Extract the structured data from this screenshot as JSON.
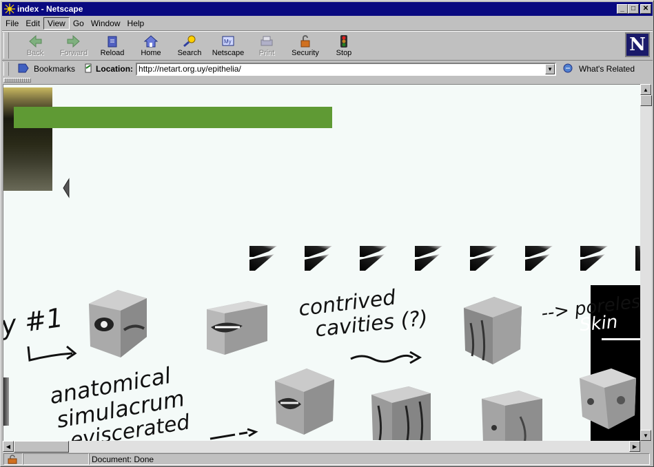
{
  "window": {
    "title": "index - Netscape"
  },
  "menu": [
    "File",
    "Edit",
    "View",
    "Go",
    "Window",
    "Help"
  ],
  "toolbar": {
    "back": "Back",
    "forward": "Forward",
    "reload": "Reload",
    "home": "Home",
    "search": "Search",
    "netscape": "Netscape",
    "print": "Print",
    "security": "Security",
    "stop": "Stop"
  },
  "locationbar": {
    "bookmarks": "Bookmarks",
    "location_label": "Location:",
    "url": "http://netart.org.uy/epithelia/",
    "related": "What's Related"
  },
  "page": {
    "green_bar_color": "#5f9a34",
    "handwriting": {
      "contrived": "contrived",
      "cavities": "cavities (?)",
      "poreless": "--> poreless",
      "skin": "Skin",
      "number": "y #1",
      "anatomical": "anatomical",
      "simulacrum": "simulacrum",
      "eviscerated": "eviscerated"
    }
  },
  "status": {
    "text": "Document: Done"
  }
}
